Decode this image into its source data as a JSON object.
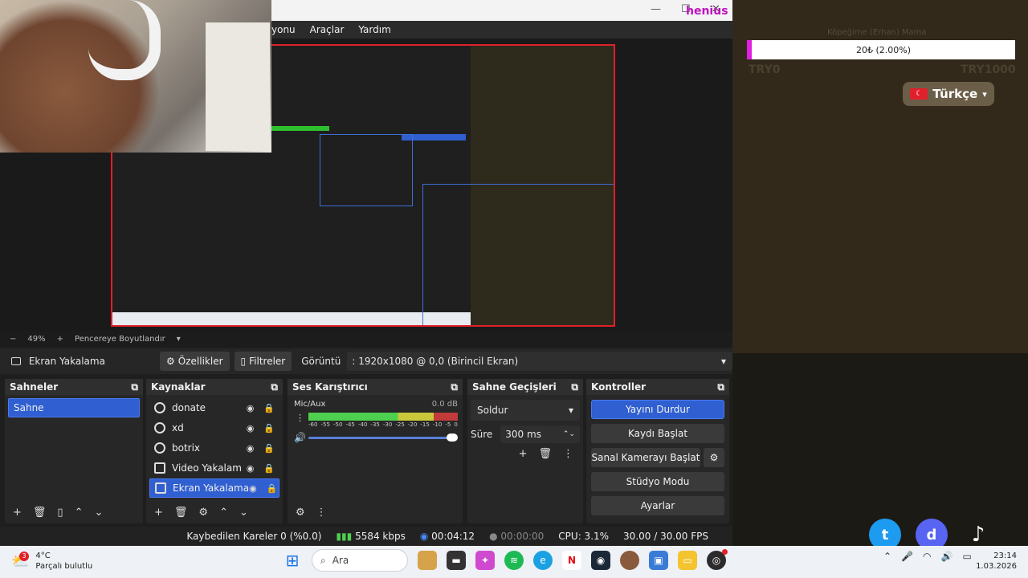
{
  "app": {
    "menu": [
      "yonu",
      "Araçlar",
      "Yardım"
    ],
    "watermark": "henius"
  },
  "preview": {
    "zoom": "49%",
    "scale_mode": "Pencereye Boyutlandır"
  },
  "source_toolbar": {
    "selected_source": "Ekran Yakalama",
    "properties": "Özellikler",
    "filters": "Filtreler",
    "display_label": "Görüntü",
    "display_value": ": 1920x1080 @ 0,0 (Birincil Ekran)"
  },
  "scenes": {
    "title": "Sahneler",
    "items": [
      "Sahne"
    ]
  },
  "sources": {
    "title": "Kaynaklar",
    "items": [
      "donate",
      "xd",
      "botrix",
      "Video Yakalama A",
      "Ekran Yakalama"
    ]
  },
  "mixer": {
    "title": "Ses Karıştırıcı",
    "channel": "Mic/Aux",
    "db": "0.0 dB",
    "ticks": [
      "-60",
      "-55",
      "-50",
      "-45",
      "-40",
      "-35",
      "-30",
      "-25",
      "-20",
      "-15",
      "-10",
      "-5",
      "0"
    ]
  },
  "transitions": {
    "title": "Sahne Geçişleri",
    "type": "Soldur",
    "duration_label": "Süre",
    "duration_value": "300 ms"
  },
  "controls": {
    "title": "Kontroller",
    "stop_stream": "Yayını Durdur",
    "start_recording": "Kaydı Başlat",
    "start_virtualcam": "Sanal Kamerayı Başlat",
    "studio_mode": "Stüdyo Modu",
    "settings": "Ayarlar"
  },
  "status": {
    "dropped": "Kaybedilen Kareler 0 (%0.0)",
    "bitrate": "5584 kbps",
    "stream_time": "00:04:12",
    "record_time": "00:00:00",
    "cpu": "CPU: 3.1%",
    "fps": "30.00 / 30.00 FPS"
  },
  "overlay": {
    "goal_title": "Köpeğime (Erhan) Mama",
    "donate_text": "20₺ (2.00%)",
    "donate_progress": 0.02,
    "goal_min": "TRY0",
    "goal_max": "TRY1000",
    "language": "Türkçe"
  },
  "taskbar": {
    "weather_temp": "4°C",
    "weather_desc": "Parçalı bulutlu",
    "weather_badge": "3",
    "search": "Ara",
    "time": "23:14",
    "date": "1.03.2026"
  },
  "colors": {
    "accent": "#2f5fd0",
    "record_red": "#e0202a",
    "donate_magenta": "#e020e0"
  }
}
